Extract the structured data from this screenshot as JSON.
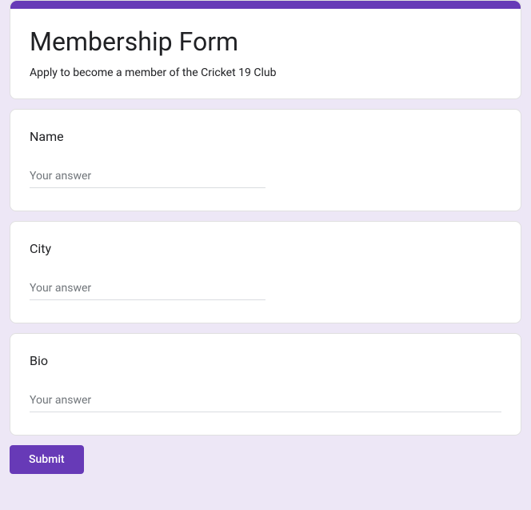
{
  "header": {
    "title": "Membership Form",
    "description": "Apply to become a member of the Cricket 19 Club"
  },
  "questions": [
    {
      "label": "Name",
      "placeholder": "Your answer",
      "full_width": false
    },
    {
      "label": "City",
      "placeholder": "Your answer",
      "full_width": false
    },
    {
      "label": "Bio",
      "placeholder": "Your answer",
      "full_width": true
    }
  ],
  "submit": {
    "label": "Submit"
  }
}
